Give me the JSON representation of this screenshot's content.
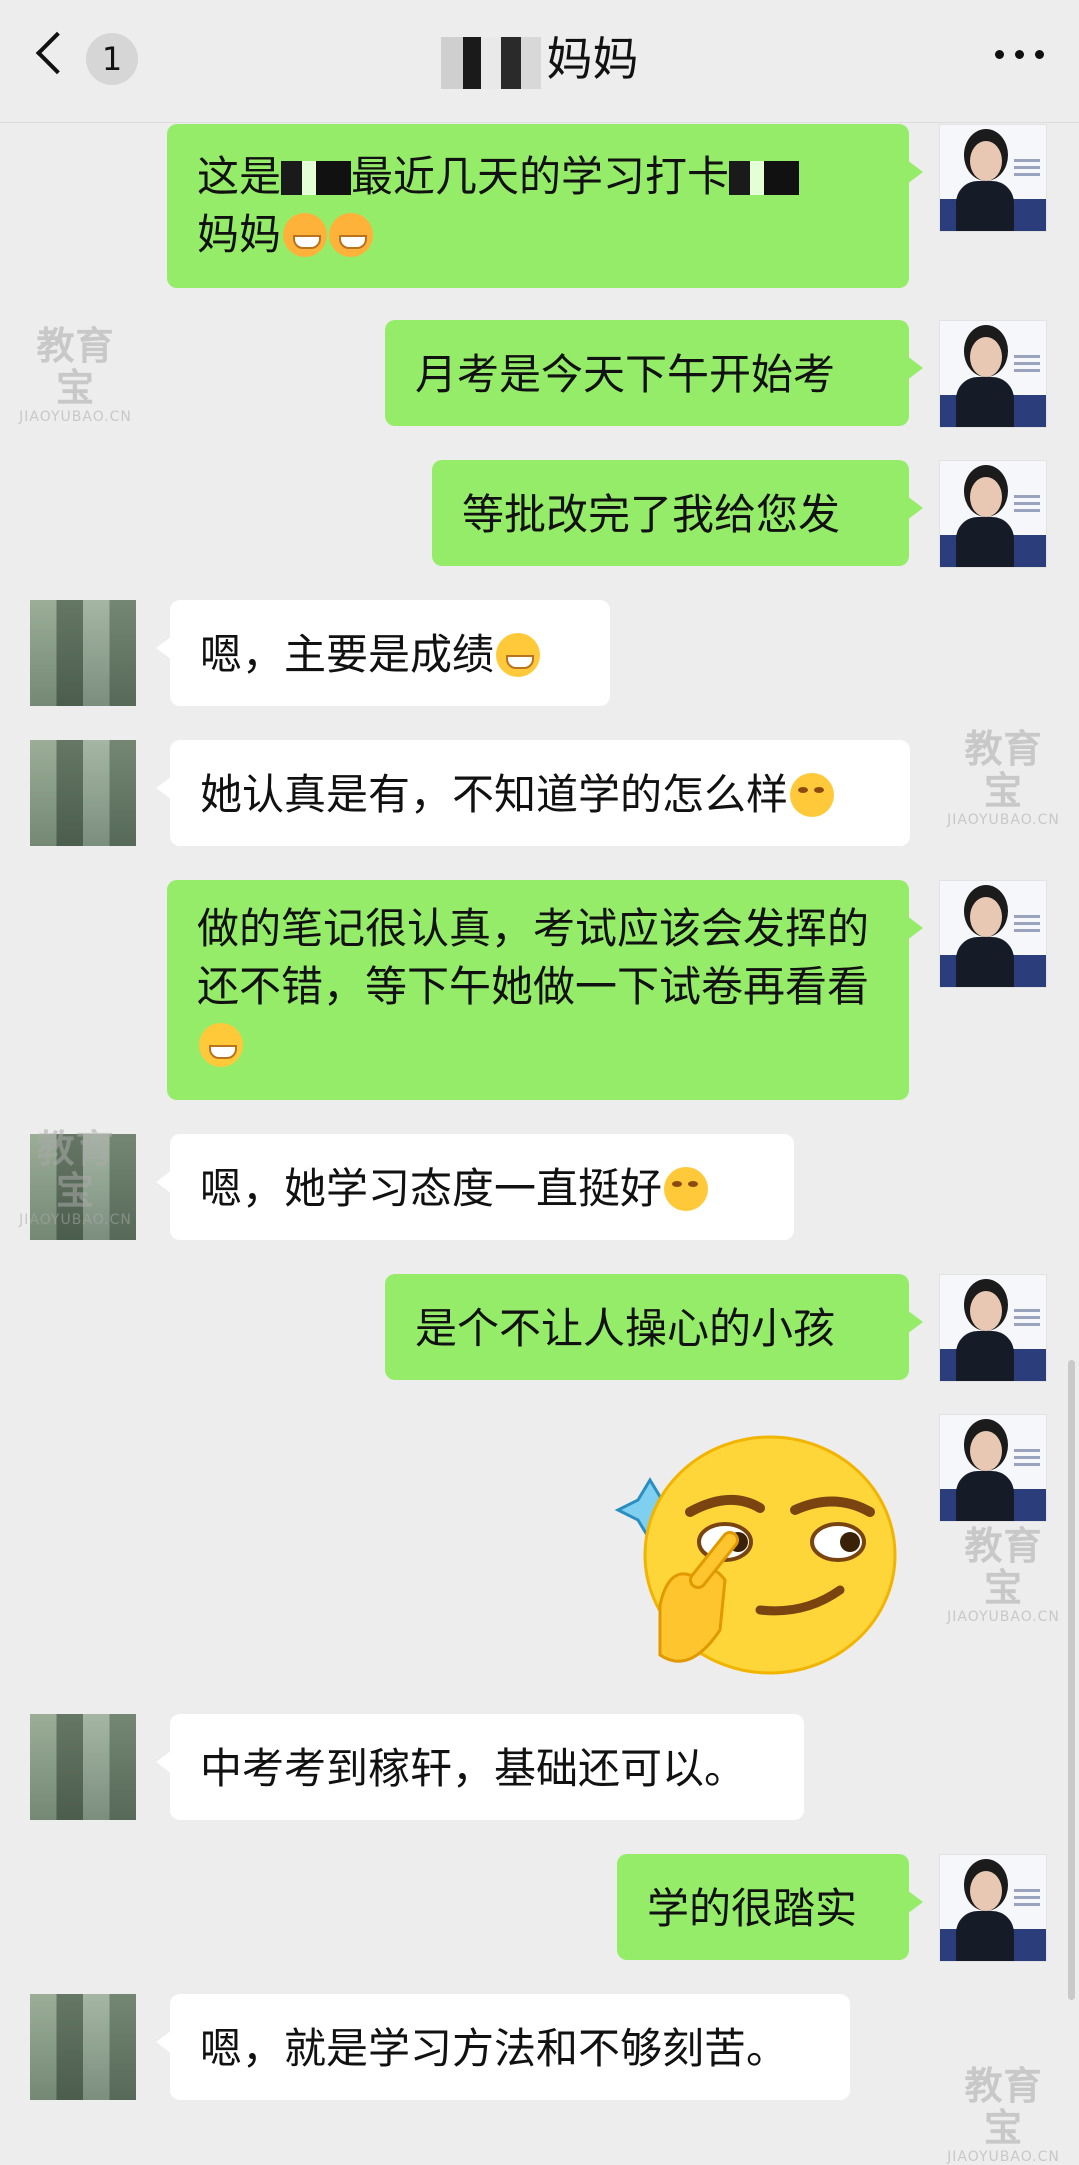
{
  "header": {
    "back_count": "1",
    "title_suffix": "妈妈"
  },
  "messages": [
    {
      "id": "m1",
      "from": "self",
      "text": "这是",
      "text2": "最近几天的学习打卡",
      "text3": "妈妈"
    },
    {
      "id": "m2",
      "from": "self",
      "text": "月考是今天下午开始考"
    },
    {
      "id": "m3",
      "from": "self",
      "text": "等批改完了我给您发"
    },
    {
      "id": "m4",
      "from": "other",
      "text": "嗯，主要是成绩"
    },
    {
      "id": "m5",
      "from": "other",
      "text": "她认真是有，不知道学的怎么样"
    },
    {
      "id": "m6",
      "from": "self",
      "text": "做的笔记很认真，考试应该会发挥的还不错，等下午她做一下试卷再看看"
    },
    {
      "id": "m7",
      "from": "other",
      "text": "嗯，她学习态度一直挺好"
    },
    {
      "id": "m8",
      "from": "self",
      "text": "是个不让人操心的小孩"
    },
    {
      "id": "m9",
      "from": "self",
      "sticker": "thinking-face-sticker"
    },
    {
      "id": "m10",
      "from": "other",
      "text": "中考考到稼轩，基础还可以。"
    },
    {
      "id": "m11",
      "from": "self",
      "text": "学的很踏实"
    },
    {
      "id": "m12",
      "from": "other",
      "text": "嗯，就是学习方法和不够刻苦。"
    }
  ],
  "watermark": {
    "big": "教育宝",
    "small": "JIAOYUBAO.CN"
  },
  "colors": {
    "self_bubble": "#95ec69",
    "other_bubble": "#ffffff",
    "background": "#ededed"
  }
}
